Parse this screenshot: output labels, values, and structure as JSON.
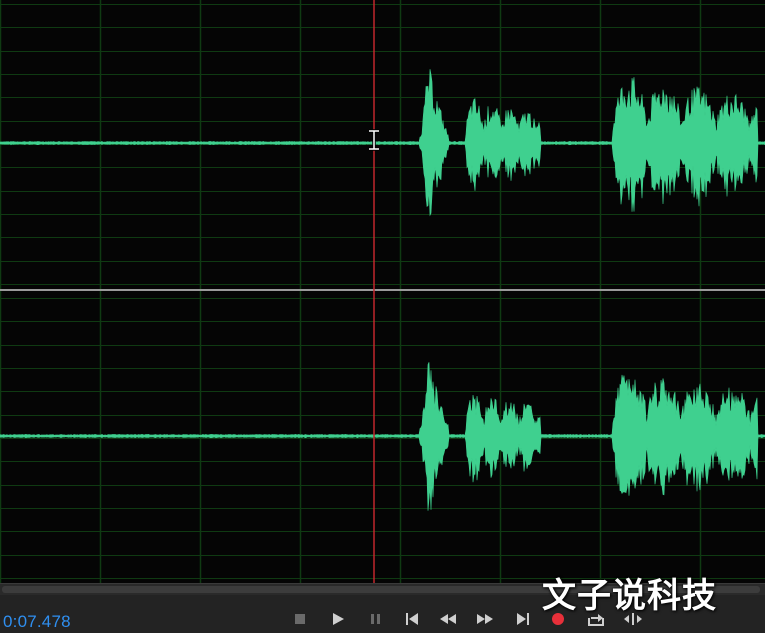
{
  "timecode": "0:07.478",
  "watermark": "文子说科技",
  "colors": {
    "waveform": "#3fd08f",
    "grid": "#0f3a12",
    "centerline": "#d97b5a",
    "playhead": "#c0272d",
    "channel_divider": "#9a9a9a",
    "timecode": "#2f8ff0",
    "record": "#e8303a"
  },
  "transport_icons": [
    "stop-icon",
    "play-icon",
    "pause-icon",
    "go-to-start-icon",
    "rewind-icon",
    "fast-forward-icon",
    "go-to-end-icon",
    "record-icon",
    "loop-icon",
    "skip-selection-icon"
  ]
}
